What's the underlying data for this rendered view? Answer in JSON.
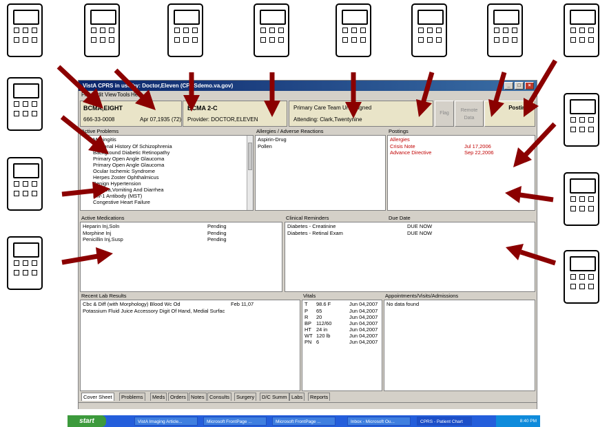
{
  "window": {
    "title": "VistA CPRS in use by: Doctor,Eleven (CPRSdemo.va.gov)",
    "controls": [
      "_",
      "□",
      "×"
    ]
  },
  "menu": [
    "File",
    "Edit",
    "View",
    "Tools",
    "Help"
  ],
  "header": {
    "patient_name": "BCMA,EIGHT",
    "ssn": "666-33-0008",
    "dob": "Apr 07,1935 (72)",
    "location": "BCMA 2-C",
    "provider": "Provider: DOCTOR,ELEVEN",
    "team": "Primary Care Team Unassigned",
    "attending": "Attending: Clark,Twentynine",
    "flag_label": "Flag",
    "remote_data_label": "Remote Data",
    "postings_label": "Postings"
  },
  "problems": {
    "title": "Active Problems",
    "items": [
      "Meningitis",
      "Personal History Of Schizophrenia",
      "Background Diabetic Retinopathy",
      "Primary Open Angle Glaucoma",
      "Primary Open Angle Glaucoma",
      "Ocular Ischemic Syndrome",
      "Herpes Zoster Ophthalmicus",
      "Benign Hypertension",
      "Nausea,Vomiting And Diarrhea",
      "Hiv-1 Antibody (MST)",
      "Congestive Heart Failure"
    ]
  },
  "allergies": {
    "title": "Allergies / Adverse Reactions",
    "items": [
      "Aspirin-Drug",
      "Pollen"
    ]
  },
  "postings": {
    "title": "Postings",
    "items": [
      {
        "name": "Allergies",
        "date": ""
      },
      {
        "name": "Crisis Note",
        "date": "Jul 17,2006"
      },
      {
        "name": "Advance Directive",
        "date": "Sep 22,2006"
      }
    ]
  },
  "medications": {
    "title": "Active Medications",
    "items": [
      {
        "name": "Heparin Inj,Soln",
        "status": "Pending"
      },
      {
        "name": "Morphine Inj",
        "status": "Pending"
      },
      {
        "name": "Penicillin Inj,Susp",
        "status": "Pending"
      }
    ]
  },
  "reminders": {
    "title": "Clinical Reminders",
    "due_title": "Due Date",
    "items": [
      {
        "name": "Diabetes - Creatinine",
        "due": "DUE NOW"
      },
      {
        "name": "Diabetes - Retinal Exam",
        "due": "DUE NOW"
      }
    ]
  },
  "labs": {
    "title": "Recent Lab Results",
    "items": [
      {
        "name": "Cbc & Diff (with Morphology) Blood   Wc Od",
        "date": "Feb 11,07"
      },
      {
        "name": "Potassium Fluid Juice Accessory Digit Of Hand, Medial Surfac",
        "date": ""
      }
    ]
  },
  "vitals": {
    "title": "Vitals",
    "items": [
      {
        "code": "T",
        "value": "98.6 F",
        "date": "Jun 04,2007"
      },
      {
        "code": "P",
        "value": "65",
        "date": "Jun 04,2007"
      },
      {
        "code": "R",
        "value": "20",
        "date": "Jun 04,2007"
      },
      {
        "code": "BP",
        "value": "112/60",
        "date": "Jun 04,2007"
      },
      {
        "code": "HT",
        "value": "24 in",
        "date": "Jun 04,2007"
      },
      {
        "code": "WT",
        "value": "120 lb",
        "date": "Jun 04,2007"
      },
      {
        "code": "PN",
        "value": "6",
        "date": "Jun 04,2007"
      }
    ]
  },
  "appointments": {
    "title": "Appointments/Visits/Admissions",
    "empty_text": "No data found"
  },
  "tabs": [
    "Cover Sheet",
    "Problems",
    "Meds",
    "Orders",
    "Notes",
    "Consults",
    "Surgery",
    "D/C Summ",
    "Labs",
    "Reports"
  ],
  "taskbar": {
    "start_label": "start",
    "tasks": [
      "VistA Imaging Article...",
      "Microsoft FrontPage ...",
      "Microsoft FrontPage ...",
      "Inbox - Microsoft Ou...",
      "CPRS - Patient Chart"
    ],
    "clock": "8:40 PM"
  },
  "annotation_colors": {
    "arrow": "#8b0000"
  }
}
